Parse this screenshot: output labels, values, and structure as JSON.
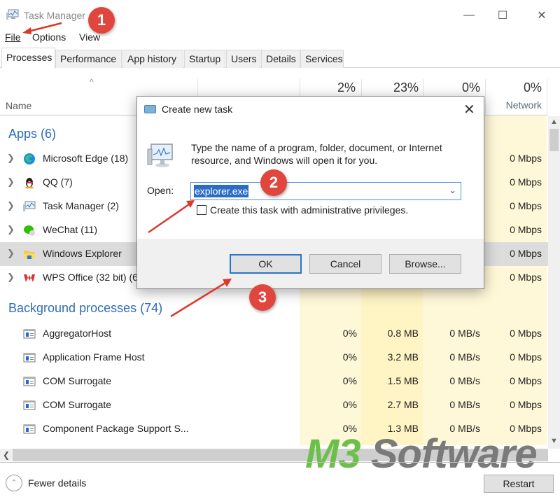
{
  "window": {
    "title": "Task Manager",
    "controls": {
      "minimize": "—",
      "maximize": "☐",
      "close": "✕"
    }
  },
  "menu": [
    {
      "label": "File"
    },
    {
      "label": "Options"
    },
    {
      "label": "View"
    }
  ],
  "tabs": [
    {
      "label": "Processes",
      "active": true
    },
    {
      "label": "Performance"
    },
    {
      "label": "App history"
    },
    {
      "label": "Startup"
    },
    {
      "label": "Users"
    },
    {
      "label": "Details"
    },
    {
      "label": "Services"
    }
  ],
  "columns": {
    "name_label": "Name",
    "sort_indicator": "^",
    "cpu_pct": "2%",
    "memory_pct": "23%",
    "disk_pct": "0%",
    "network_pct": "0%",
    "network_label": "Network"
  },
  "groups": {
    "apps": {
      "label": "Apps (6)"
    },
    "background": {
      "label": "Background processes (74)"
    }
  },
  "apps": [
    {
      "name": "Microsoft Edge (18)",
      "icon": "edge-icon",
      "network": "0 Mbps"
    },
    {
      "name": "QQ (7)",
      "icon": "qq-penguin-icon",
      "network": "0 Mbps"
    },
    {
      "name": "Task Manager (2)",
      "icon": "task-manager-icon",
      "network": "0 Mbps"
    },
    {
      "name": "WeChat (11)",
      "icon": "wechat-icon",
      "network": "0 Mbps"
    },
    {
      "name": "Windows Explorer",
      "icon": "folder-icon",
      "network": "0 Mbps",
      "selected": true
    },
    {
      "name": "WPS Office (32 bit) (6",
      "icon": "wps-icon",
      "network": "0 Mbps"
    }
  ],
  "background": [
    {
      "name": "AggregatorHost",
      "cpu": "0%",
      "memory": "0.8 MB",
      "disk": "0 MB/s",
      "network": "0 Mbps"
    },
    {
      "name": "Application Frame Host",
      "cpu": "0%",
      "memory": "3.2 MB",
      "disk": "0 MB/s",
      "network": "0 Mbps"
    },
    {
      "name": "COM Surrogate",
      "cpu": "0%",
      "memory": "1.5 MB",
      "disk": "0 MB/s",
      "network": "0 Mbps"
    },
    {
      "name": "COM Surrogate",
      "cpu": "0%",
      "memory": "2.7 MB",
      "disk": "0 MB/s",
      "network": "0 Mbps"
    },
    {
      "name": "Component Package Support S...",
      "cpu": "0%",
      "memory": "1.3 MB",
      "disk": "0 MB/s",
      "network": "0 Mbps"
    }
  ],
  "footer": {
    "fewer_details": "Fewer details",
    "restart": "Restart"
  },
  "dialog": {
    "title": "Create new task",
    "description": "Type the name of a program, folder, document, or Internet resource, and Windows will open it for you.",
    "open_label": "Open:",
    "open_value": "explorer.exe",
    "admin_checkbox_label": "Create this task with administrative privileges.",
    "admin_checked": false,
    "ok": "OK",
    "cancel": "Cancel",
    "browse": "Browse..."
  },
  "annotations": [
    "1",
    "2",
    "3"
  ],
  "watermark": {
    "part1": "M3",
    "part2": " Software"
  },
  "colors": {
    "group_header": "#2f6db5",
    "heat_cell": "#fff4c4",
    "badge": "#e0463d",
    "selection": "#2d6cc6",
    "primary_border": "#2b74c9"
  }
}
